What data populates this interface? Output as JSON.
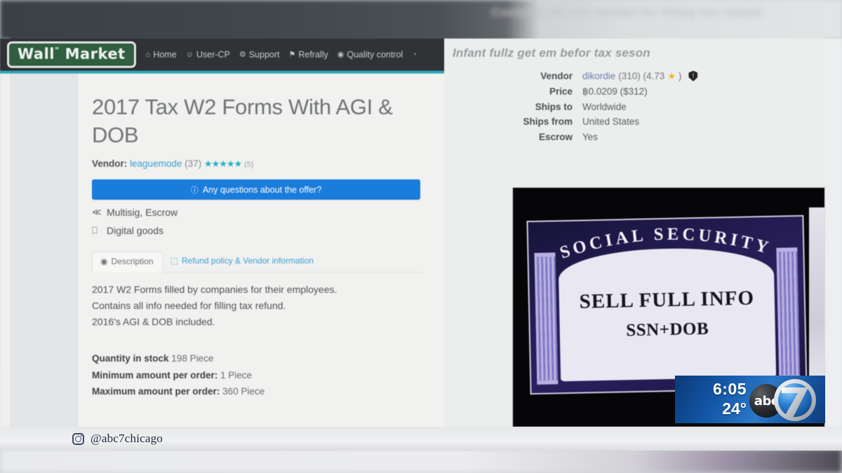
{
  "broadcast": {
    "network_bug": {
      "time": "6:05",
      "temperature": "24°",
      "abc_text": "abc",
      "channel": "7"
    },
    "social_handle": "@abc7chicago",
    "social_icon": "instagram-icon",
    "ticker_blurred_text": "Contains all info needed for filling tax refund."
  },
  "site": {
    "logo": {
      "prefix": "Wall",
      "sup": "\"",
      "suffix": "Market"
    },
    "nav": [
      {
        "icon": "⌂",
        "label": "Home",
        "icon_name": "home-icon"
      },
      {
        "icon": "☺",
        "label": "User-CP",
        "icon_name": "user-icon"
      },
      {
        "icon": "⚙",
        "label": "Support",
        "icon_name": "gear-icon"
      },
      {
        "icon": "⚑",
        "label": "Refrally",
        "icon_name": "flag-icon"
      },
      {
        "icon": "◉",
        "label": "Quality control",
        "icon_name": "badge-icon"
      },
      {
        "icon": "◔",
        "label": "",
        "icon_name": "partial-icon"
      }
    ],
    "accent_color": "#2fa7bd"
  },
  "listing": {
    "title": "2017 Tax W2 Forms With AGI & DOB",
    "vendor_label": "Vendor:",
    "vendor_name": "leaguemode",
    "vendor_sales": "(37)",
    "stars": "★★★★★",
    "review_count": "(5)",
    "question_button": "Any questions about the offer?",
    "question_icon": "info-circle-icon",
    "meta": [
      {
        "icon": "≪",
        "icon_name": "share-icon",
        "text": "Multisig, Escrow"
      },
      {
        "icon": "⎕",
        "icon_name": "monitor-icon",
        "text": "Digital goods"
      }
    ],
    "tabs": [
      {
        "label": "Description",
        "icon": "◉",
        "icon_name": "circle-icon",
        "active": true
      },
      {
        "label": "Refund policy & Vendor information",
        "icon": "⬚",
        "icon_name": "clipboard-icon",
        "active": false
      }
    ],
    "description": [
      "2017 W2 Forms filled by companies for their employees.",
      "Contains all info needed for filling tax refund.",
      "2016's AGI & DOB included."
    ],
    "specs": [
      {
        "label": "Quantity in stock",
        "value": "198 Piece"
      },
      {
        "label": "Minimum amount per order:",
        "value": "1 Piece"
      },
      {
        "label": "Maximum amount per order:",
        "value": "360 Piece"
      }
    ]
  },
  "panel": {
    "title": "Infant fullz get em befor tax seson",
    "details": [
      {
        "key": "Vendor",
        "value": "dikordie",
        "extra": "(310) (4.73",
        "star": "★",
        "close": ")",
        "badge": "verified-shield-icon",
        "is_link": true
      },
      {
        "key": "Price",
        "value": "฿0.0209 ($312)",
        "is_link": false
      },
      {
        "key": "Ships to",
        "value": "Worldwide",
        "is_link": false
      },
      {
        "key": "Ships from",
        "value": "United States",
        "is_link": false
      },
      {
        "key": "Escrow",
        "value": "Yes",
        "is_link": false
      }
    ],
    "product_image": {
      "alt": "social-security-card-photo",
      "arch_text": "SOCIAL SECURITY",
      "line1": "SELL FULL INFO",
      "line2": "SSN+DOB"
    }
  }
}
